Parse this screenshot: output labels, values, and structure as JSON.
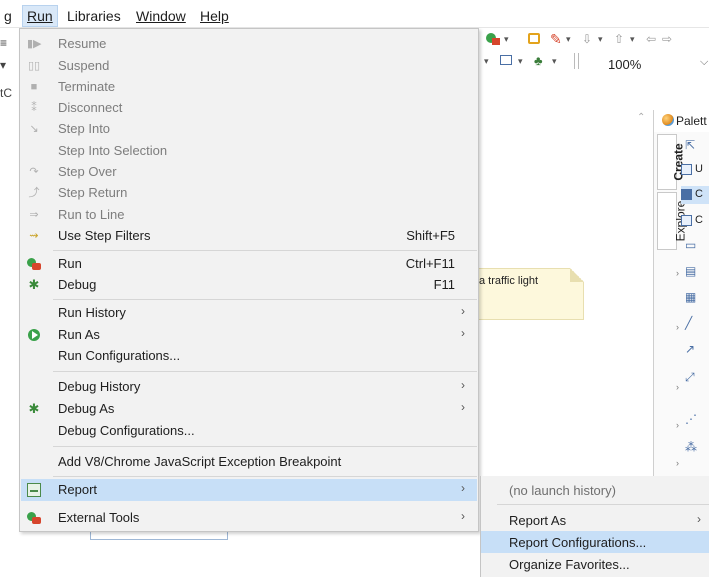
{
  "menubar": {
    "items": [
      {
        "label": "g",
        "underline": ""
      },
      {
        "label": "Run",
        "underline": "R"
      },
      {
        "label": "Libraries",
        "underline": ""
      },
      {
        "label": "Window",
        "underline": "W"
      },
      {
        "label": "Help",
        "underline": "H"
      }
    ]
  },
  "background": {
    "zoom": "100%",
    "left_stub": "tC",
    "note_text": "a traffic light",
    "palette_title": "Palett",
    "tabs": [
      "Create",
      "Explore"
    ],
    "palette_items": [
      "U",
      "C",
      "C"
    ]
  },
  "run_menu": {
    "items": [
      {
        "label": "Resume",
        "icon": "resume-icon",
        "disabled": true
      },
      {
        "label": "Suspend",
        "icon": "suspend-icon",
        "disabled": true
      },
      {
        "label": "Terminate",
        "icon": "terminate-icon",
        "disabled": true
      },
      {
        "label": "Disconnect",
        "icon": "disconnect-icon",
        "disabled": true
      },
      {
        "label": "Step Into",
        "icon": "step-into-icon",
        "disabled": true
      },
      {
        "label": "Step Into Selection",
        "icon": "",
        "disabled": true
      },
      {
        "label": "Step Over",
        "icon": "step-over-icon",
        "disabled": true
      },
      {
        "label": "Step Return",
        "icon": "step-return-icon",
        "disabled": true
      },
      {
        "label": "Run to Line",
        "icon": "run-to-line-icon",
        "disabled": true
      },
      {
        "label": "Use Step Filters",
        "icon": "step-filters-icon",
        "disabled": false,
        "accelerator": "Shift+F5"
      },
      {
        "label": "Run",
        "icon": "run-icon",
        "disabled": false,
        "accelerator": "Ctrl+F11"
      },
      {
        "label": "Debug",
        "icon": "debug-icon",
        "disabled": false,
        "accelerator": "F11"
      },
      {
        "label": "Run History",
        "icon": "",
        "disabled": false,
        "submenu": true
      },
      {
        "label": "Run As",
        "icon": "run-as-icon",
        "disabled": false,
        "submenu": true
      },
      {
        "label": "Run Configurations...",
        "icon": "",
        "disabled": false
      },
      {
        "label": "Debug History",
        "icon": "",
        "disabled": false,
        "submenu": true
      },
      {
        "label": "Debug As",
        "icon": "debug-as-icon",
        "disabled": false,
        "submenu": true
      },
      {
        "label": "Debug Configurations...",
        "icon": "",
        "disabled": false
      },
      {
        "label": "Add V8/Chrome JavaScript Exception Breakpoint",
        "icon": "",
        "disabled": false
      },
      {
        "label": "Report",
        "icon": "report-icon",
        "disabled": false,
        "submenu": true,
        "highlighted": true
      },
      {
        "label": "External Tools",
        "icon": "external-tools-icon",
        "disabled": false,
        "submenu": true
      }
    ],
    "submenu_arrow": "›"
  },
  "report_submenu": {
    "items": [
      {
        "label": "(no launch history)",
        "disabled": true
      },
      {
        "label": "Report As",
        "submenu": true
      },
      {
        "label": "Report Configurations...",
        "highlighted": true
      },
      {
        "label": "Organize Favorites..."
      }
    ]
  },
  "colors": {
    "menu_bg": "#f2f2f2",
    "highlight": "#c7dff7",
    "disabled_text": "#7d7d7d"
  }
}
